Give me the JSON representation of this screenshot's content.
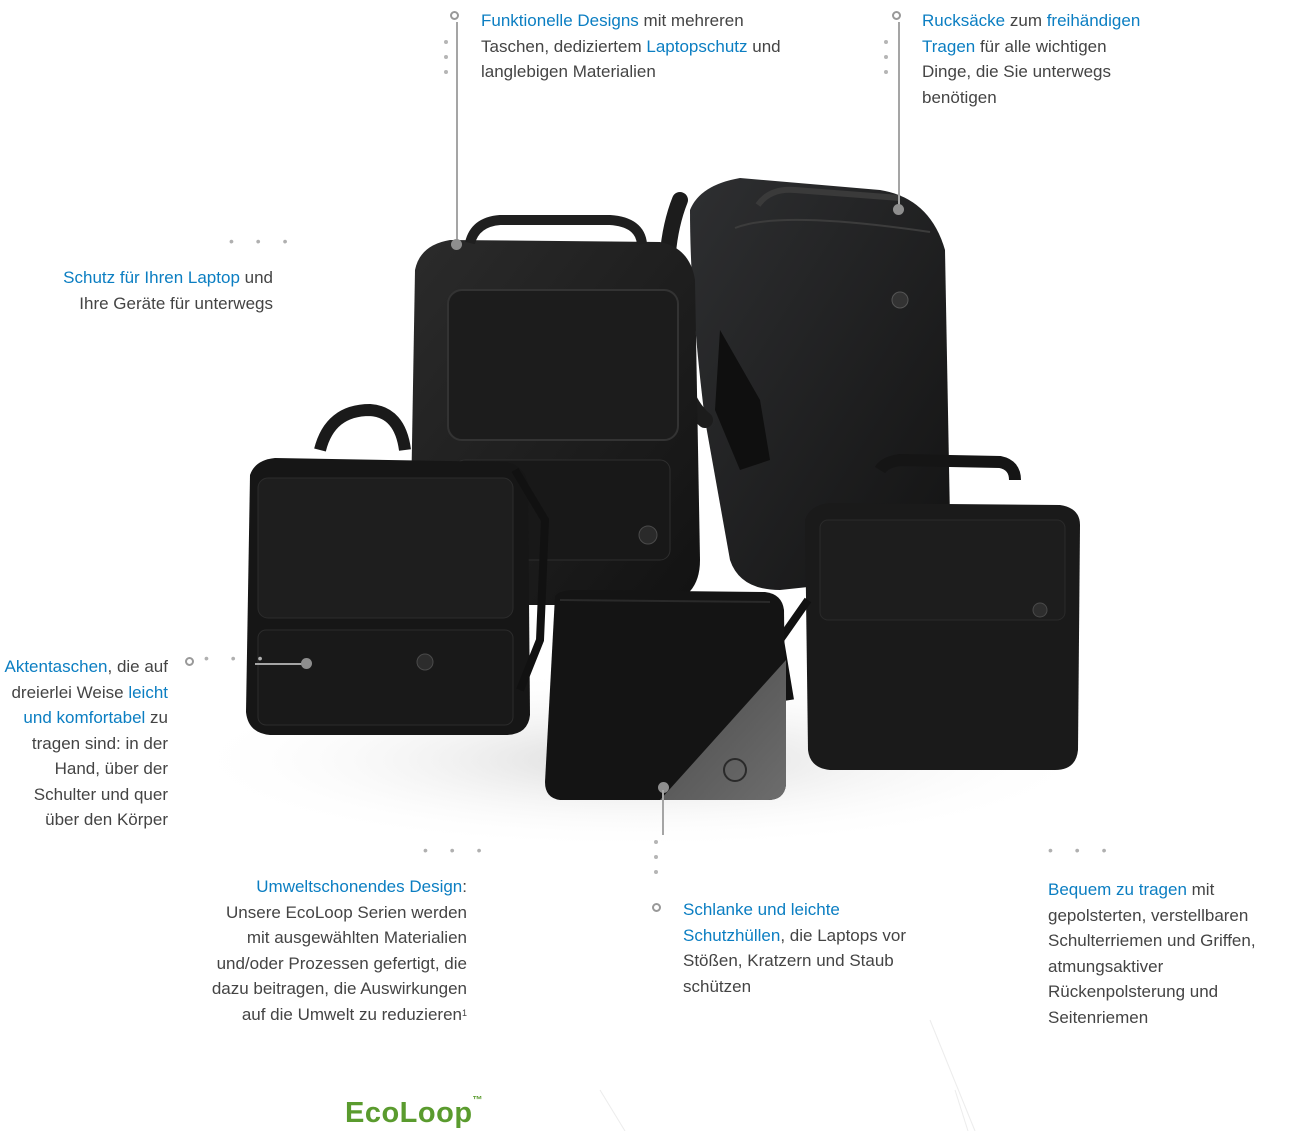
{
  "callouts": {
    "funktionelle": {
      "hl1": "Funktionelle Designs",
      "t1": " mit mehreren Taschen, dediziertem ",
      "hl2": "Laptopschutz",
      "t2": " und langlebigen Materialien"
    },
    "rucksaecke": {
      "hl1": "Rucksäcke",
      "t1": " zum ",
      "hl2": "freihändigen Tragen",
      "t2": " für alle wichtigen Dinge, die Sie unterwegs benötigen"
    },
    "schutz": {
      "hl1": "Schutz für Ihren Laptop",
      "t1": " und Ihre Geräte für unterwegs"
    },
    "aktentaschen": {
      "hl1": "Aktentaschen",
      "t1": ", die auf dreierlei Weise ",
      "hl2": "leicht und komfortabel",
      "t2": " zu tragen sind: in der Hand, über der Schulter und quer über den Körper"
    },
    "umwelt": {
      "hl1": "Umweltschonendes Design",
      "t1": ": Unsere EcoLoop Serien werden mit ausgewählten Materialien und/oder Prozessen gefertigt, die dazu beitragen, die Auswirkungen auf die Umwelt zu reduzieren",
      "footnote": "1"
    },
    "schlanke": {
      "hl1": "Schlanke und leichte Schutzhüllen",
      "t1": ", die Laptops vor Stößen, Kratzern und Staub schützen"
    },
    "bequem": {
      "hl1": "Bequem zu tragen",
      "t1": " mit gepolsterten, verstellbaren Schulterriemen und Griffen, atmungsaktiver Rückenpolsterung und Seitenriemen"
    }
  },
  "logo": {
    "brand": "EcoLoop",
    "tm": "™"
  },
  "colors": {
    "highlight": "#0b7ec2",
    "body_text": "#444444",
    "ecoloop_green": "#5a9b2e",
    "bag_black": "#1a1a1a"
  },
  "icons": [
    "dell-logo"
  ]
}
